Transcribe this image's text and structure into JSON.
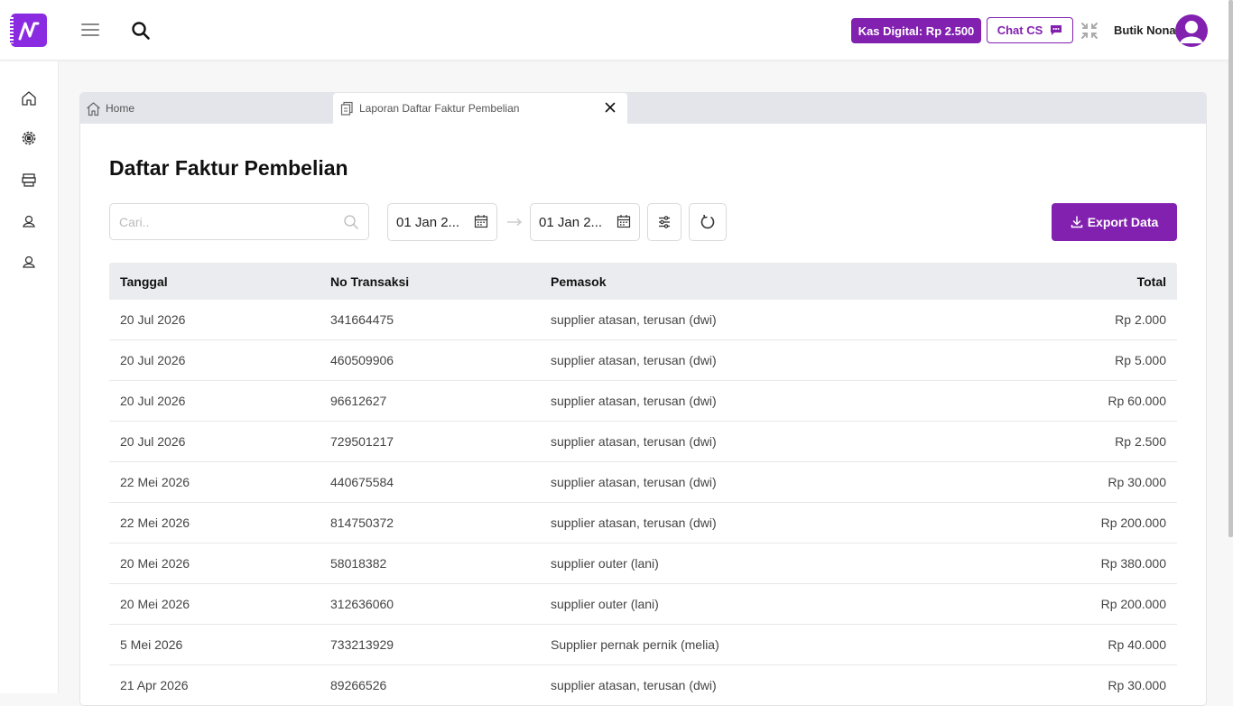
{
  "header": {
    "kas_label": "Kas Digital: Rp 2.500",
    "chat_label": "Chat CS",
    "user_name": "Butik Nona",
    "accent": "#8221b0"
  },
  "tabs": {
    "home_label": "Home",
    "active_label": "Laporan Daftar Faktur Pembelian"
  },
  "page": {
    "title": "Daftar Faktur Pembelian",
    "search_placeholder": "Cari..",
    "date_from": "01 Jan 2...",
    "date_to": "01 Jan 2...",
    "export_label": "Export Data"
  },
  "table": {
    "headers": [
      "Tanggal",
      "No Transaksi",
      "Pemasok",
      "Total"
    ],
    "rows": [
      [
        "20 Jul 2026",
        "341664475",
        "supplier atasan, terusan (dwi)",
        "Rp 2.000"
      ],
      [
        "20 Jul 2026",
        "460509906",
        "supplier atasan, terusan (dwi)",
        "Rp 5.000"
      ],
      [
        "20 Jul 2026",
        "96612627",
        "supplier atasan, terusan (dwi)",
        "Rp 60.000"
      ],
      [
        "20 Jul 2026",
        "729501217",
        "supplier atasan, terusan (dwi)",
        "Rp 2.500"
      ],
      [
        "22 Mei 2026",
        "440675584",
        "supplier atasan, terusan (dwi)",
        "Rp 30.000"
      ],
      [
        "22 Mei 2026",
        "814750372",
        "supplier atasan, terusan (dwi)",
        "Rp 200.000"
      ],
      [
        "20 Mei 2026",
        "58018382",
        "supplier outer (lani)",
        "Rp 380.000"
      ],
      [
        "20 Mei 2026",
        "312636060",
        "supplier outer (lani)",
        "Rp 200.000"
      ],
      [
        "5 Mei 2026",
        "733213929",
        "Supplier pernak pernik (melia)",
        "Rp 40.000"
      ],
      [
        "21 Apr 2026",
        "89266526",
        "supplier atasan, terusan (dwi)",
        "Rp 30.000"
      ]
    ]
  }
}
